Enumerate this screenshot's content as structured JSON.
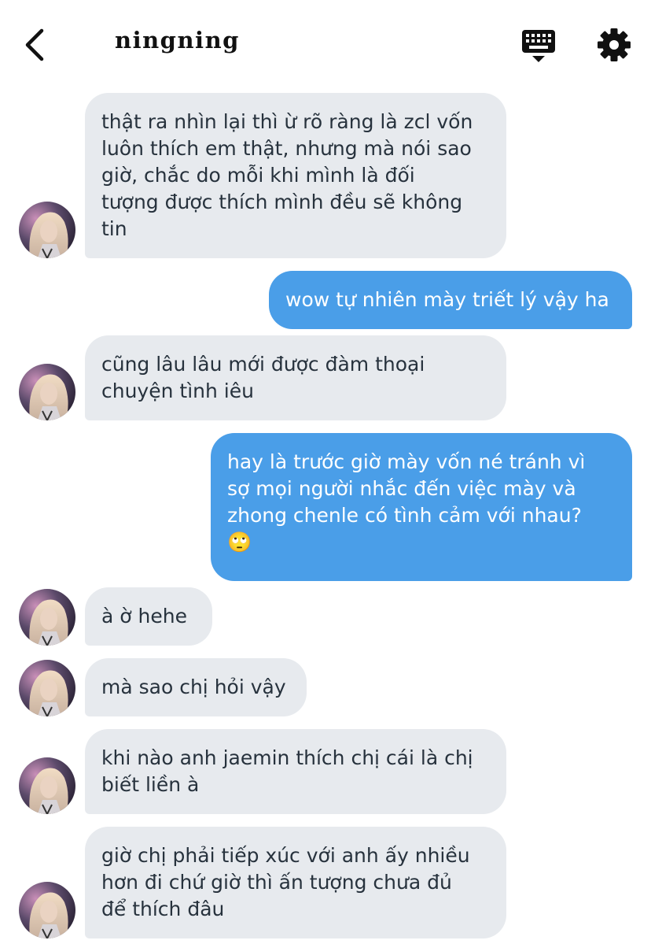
{
  "header": {
    "title": "ningning",
    "back_icon": "chevron-left-icon",
    "keyboard_icon": "keyboard-icon",
    "settings_icon": "gear-icon"
  },
  "messages": [
    {
      "from": "them",
      "text": "thật ra nhìn lại thì ừ rõ ràng là zcl vốn\nluôn thích em thật, nhưng mà nói sao\ngiờ, chắc do mỗi khi mình là đối\ntượng được thích mình đều sẽ không\ntin"
    },
    {
      "from": "me",
      "text": "wow tự nhiên mày triết lý vậy ha"
    },
    {
      "from": "them",
      "text": "cũng lâu lâu mới được đàm thoại\nchuyện tình iêu"
    },
    {
      "from": "me",
      "text": "hay là trước giờ mày vốn né tránh vì\nsợ mọi người nhắc đến việc mày và\nzhong chenle có tình cảm với nhau?\n🙄"
    },
    {
      "from": "them",
      "text": "à ờ hehe"
    },
    {
      "from": "them",
      "text": "mà sao chị hỏi vậy"
    },
    {
      "from": "them",
      "text": "khi nào anh jaemin thích chị cái là chị\nbiết liền à"
    },
    {
      "from": "them",
      "text": "giờ chị phải tiếp xúc với anh ấy nhiều\nhơn đi chứ giờ thì ấn tượng chưa đủ\nđể thích đâu"
    }
  ],
  "colors": {
    "incoming_bubble": "#e7eaee",
    "outgoing_bubble": "#4a9ee8",
    "incoming_text": "#27323d",
    "outgoing_text": "#ffffff"
  }
}
